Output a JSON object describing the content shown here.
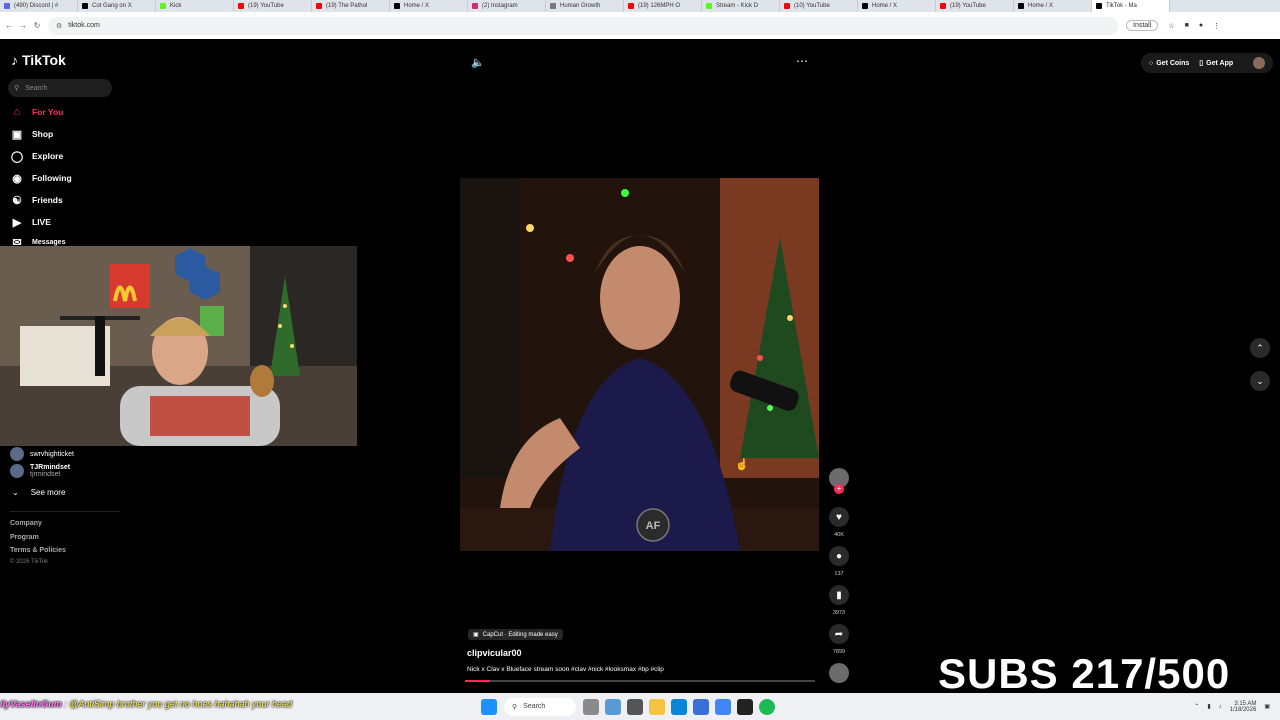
{
  "browser": {
    "tabs": [
      {
        "label": "(490) Discord | #",
        "color": "#5865f2"
      },
      {
        "label": "Cot Gang on X",
        "color": "#000000"
      },
      {
        "label": "Kick",
        "color": "#53fc18"
      },
      {
        "label": "(19) YouTube",
        "color": "#ff0000"
      },
      {
        "label": "(19) The Pathol",
        "color": "#ff0000"
      },
      {
        "label": "Home / X",
        "color": "#000000"
      },
      {
        "label": "(2) Instagram",
        "color": "#d62976"
      },
      {
        "label": "Human Growth",
        "color": "#777777"
      },
      {
        "label": "(19) 126MPH O",
        "color": "#ff0000"
      },
      {
        "label": "Stream - Kick D",
        "color": "#53fc18"
      },
      {
        "label": "(10) YouTube",
        "color": "#ff0000"
      },
      {
        "label": "Home / X",
        "color": "#000000"
      },
      {
        "label": "(19) YouTube",
        "color": "#ff0000"
      },
      {
        "label": "Home / X",
        "color": "#000000"
      },
      {
        "label": "TikTok - Ma",
        "color": "#000000"
      }
    ],
    "url": "tiktok.com",
    "install_label": "Install"
  },
  "tiktok": {
    "logo": "TikTok",
    "search_placeholder": "Search",
    "nav": [
      {
        "label": "For You",
        "icon": "home-icon",
        "active": true
      },
      {
        "label": "Shop",
        "icon": "shop-icon"
      },
      {
        "label": "Explore",
        "icon": "compass-icon"
      },
      {
        "label": "Following",
        "icon": "following-icon"
      },
      {
        "label": "Friends",
        "icon": "friends-icon"
      },
      {
        "label": "LIVE",
        "icon": "live-icon"
      },
      {
        "label": "Messages",
        "icon": "messages-icon"
      }
    ],
    "following_accounts": [
      {
        "name": "swrvhighticket",
        "handle": ""
      },
      {
        "name": "TJRmindset",
        "handle": "tjrmindset"
      }
    ],
    "see_more": "See more",
    "footer": [
      "Company",
      "Program",
      "Terms & Policies"
    ],
    "copyright": "© 2026 TikTok",
    "get_coins": "Get Coins",
    "get_app": "Get App",
    "video": {
      "capcut_tag": "CapCut · Editing made easy",
      "username": "clipvicular00",
      "caption": "Nick x Clav x Blueface stream soon #clav #nick #looksmax #bp #clip",
      "progress": 0.07
    },
    "actions": {
      "likes": "40K",
      "comments": "137",
      "saves": "3973",
      "shares": "7899"
    }
  },
  "overlay": {
    "subs": "SUBS 217/500",
    "chat": "@AntiSimp brother you get no hoes hahahah your head",
    "chat_user": "ilyVaselinGum"
  },
  "taskbar": {
    "search": "Search",
    "time": "3:15 AM",
    "date": "1/18/2026"
  },
  "colors": {
    "accent": "#fe2c55"
  }
}
